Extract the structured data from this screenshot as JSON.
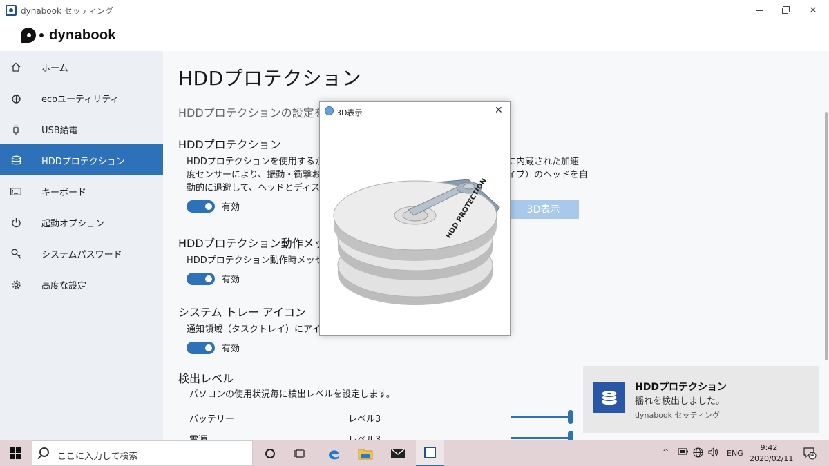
{
  "window": {
    "title": "dynabook セッティング"
  },
  "logo": {
    "text": "dynabook"
  },
  "sidebar": {
    "items": [
      {
        "label": "ホーム",
        "icon": "home-icon"
      },
      {
        "label": "ecoユーティリティ",
        "icon": "eco-icon"
      },
      {
        "label": "USB給電",
        "icon": "usb-icon"
      },
      {
        "label": "HDDプロテクション",
        "icon": "database-icon",
        "active": true
      },
      {
        "label": "キーボード",
        "icon": "keyboard-icon"
      },
      {
        "label": "起動オプション",
        "icon": "power-icon"
      },
      {
        "label": "システムパスワード",
        "icon": "key-icon"
      },
      {
        "label": "高度な設定",
        "icon": "gear-icon"
      }
    ]
  },
  "main": {
    "title": "HDDプロテクション",
    "description": "HDDプロテクションの設定を行",
    "sections": {
      "hdd": {
        "title": "HDDプロテクション",
        "text_line1": "HDDプロテクションを使用するかどう",
        "text_line2": "度センサーにより、振動・衝撃および",
        "text_line3": "動的に退避して、ヘッドとディスクの",
        "text_right1": "に内蔵された加速",
        "text_right2": "イブ）のヘッドを自",
        "toggle_label": "有効",
        "button_3d": "3D表示"
      },
      "message": {
        "title": "HDDプロテクション動作メッセー",
        "text": "HDDプロテクション動作時メッセージ",
        "toggle_label": "有効"
      },
      "tray": {
        "title": "システム トレー アイコン",
        "text": "通知領域（タスクトレイ）にアイコン",
        "toggle_label": "有効"
      },
      "level": {
        "title": "検出レベル",
        "text": "パソコンの使用状況毎に検出レベルを設定します。",
        "rows": [
          {
            "label": "バッテリー",
            "value": "レベル3"
          },
          {
            "label": "電源",
            "value": "レベル3"
          }
        ]
      }
    }
  },
  "dialog": {
    "title": "3D表示",
    "disk_label": "HDD PROTECTION"
  },
  "toast": {
    "title": "HDDプロテクション",
    "message": "揺れを検出しました。",
    "source": "dynabook セッティング"
  },
  "taskbar": {
    "search_placeholder": "ここに入力して検索",
    "language": "ENG",
    "time": "9:42",
    "date": "2020/02/11",
    "notification_count": "4"
  }
}
